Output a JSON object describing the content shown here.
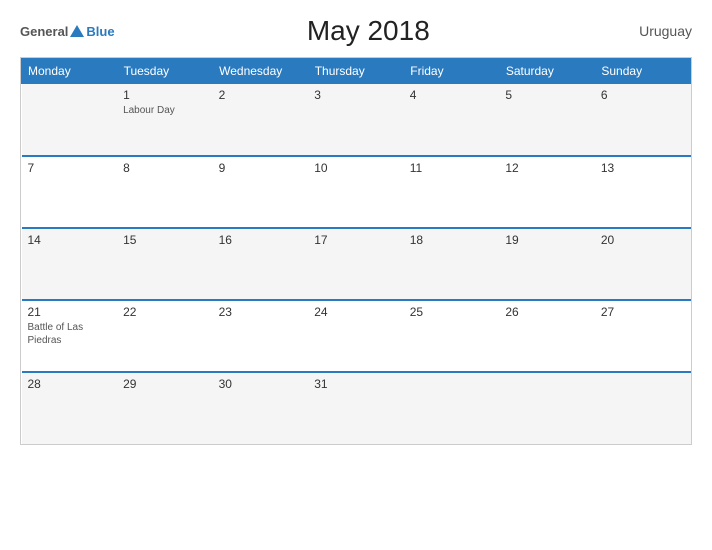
{
  "header": {
    "logo": {
      "general": "General",
      "blue": "Blue",
      "triangle": true
    },
    "title": "May 2018",
    "country": "Uruguay"
  },
  "calendar": {
    "weekdays": [
      "Monday",
      "Tuesday",
      "Wednesday",
      "Thursday",
      "Friday",
      "Saturday",
      "Sunday"
    ],
    "weeks": [
      [
        {
          "date": "",
          "event": ""
        },
        {
          "date": "1",
          "event": "Labour Day"
        },
        {
          "date": "2",
          "event": ""
        },
        {
          "date": "3",
          "event": ""
        },
        {
          "date": "4",
          "event": ""
        },
        {
          "date": "5",
          "event": ""
        },
        {
          "date": "6",
          "event": ""
        }
      ],
      [
        {
          "date": "7",
          "event": ""
        },
        {
          "date": "8",
          "event": ""
        },
        {
          "date": "9",
          "event": ""
        },
        {
          "date": "10",
          "event": ""
        },
        {
          "date": "11",
          "event": ""
        },
        {
          "date": "12",
          "event": ""
        },
        {
          "date": "13",
          "event": ""
        }
      ],
      [
        {
          "date": "14",
          "event": ""
        },
        {
          "date": "15",
          "event": ""
        },
        {
          "date": "16",
          "event": ""
        },
        {
          "date": "17",
          "event": ""
        },
        {
          "date": "18",
          "event": ""
        },
        {
          "date": "19",
          "event": ""
        },
        {
          "date": "20",
          "event": ""
        }
      ],
      [
        {
          "date": "21",
          "event": "Battle of Las Piedras"
        },
        {
          "date": "22",
          "event": ""
        },
        {
          "date": "23",
          "event": ""
        },
        {
          "date": "24",
          "event": ""
        },
        {
          "date": "25",
          "event": ""
        },
        {
          "date": "26",
          "event": ""
        },
        {
          "date": "27",
          "event": ""
        }
      ],
      [
        {
          "date": "28",
          "event": ""
        },
        {
          "date": "29",
          "event": ""
        },
        {
          "date": "30",
          "event": ""
        },
        {
          "date": "31",
          "event": ""
        },
        {
          "date": "",
          "event": ""
        },
        {
          "date": "",
          "event": ""
        },
        {
          "date": "",
          "event": ""
        }
      ]
    ]
  }
}
